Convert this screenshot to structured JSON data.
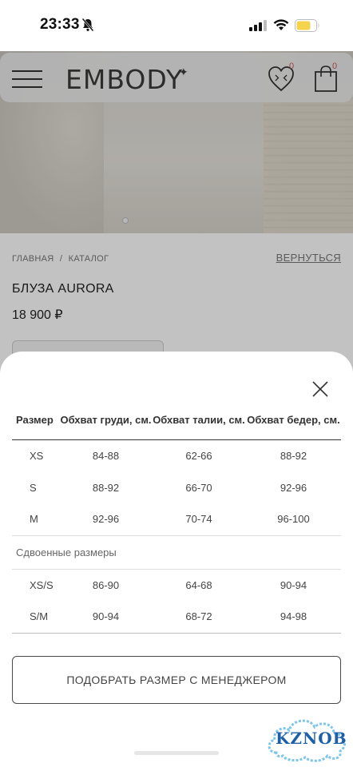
{
  "status_bar": {
    "time": "23:33"
  },
  "header": {
    "logo": "EMBODY",
    "logo_mark": "✦",
    "wishlist_count": "0",
    "cart_count": "0"
  },
  "breadcrumb": {
    "home": "ГЛАВНАЯ",
    "separator": "/",
    "catalog": "КАТАЛОГ",
    "back": "ВЕРНУТЬСЯ"
  },
  "product": {
    "title": "БЛУЗА AURORA",
    "price": "18 900 ₽"
  },
  "size_chart": {
    "headers": {
      "size": "Размер",
      "chest": "Обхват груди, см.",
      "waist": "Обхват талии, см.",
      "hips": "Обхват бедер, см."
    },
    "rows": [
      {
        "size": "XS",
        "chest": "84-88",
        "waist": "62-66",
        "hips": "88-92"
      },
      {
        "size": "S",
        "chest": "88-92",
        "waist": "66-70",
        "hips": "92-96"
      },
      {
        "size": "M",
        "chest": "92-96",
        "waist": "70-74",
        "hips": "96-100"
      }
    ],
    "double_sizes_label": "Сдвоенные размеры",
    "double_rows": [
      {
        "size": "XS/S",
        "chest": "86-90",
        "waist": "64-68",
        "hips": "90-94"
      },
      {
        "size": "S/M",
        "chest": "90-94",
        "waist": "68-72",
        "hips": "94-98"
      }
    ]
  },
  "manager_button": {
    "label": "ПОДОБРАТЬ РАЗМЕР С МЕНЕДЖЕРОМ"
  },
  "watermark": {
    "text": "KZNOB"
  },
  "colors": {
    "accent_badge": "#c65a5a",
    "battery": "#f5d34a",
    "watermark": "#1f5fa8"
  }
}
